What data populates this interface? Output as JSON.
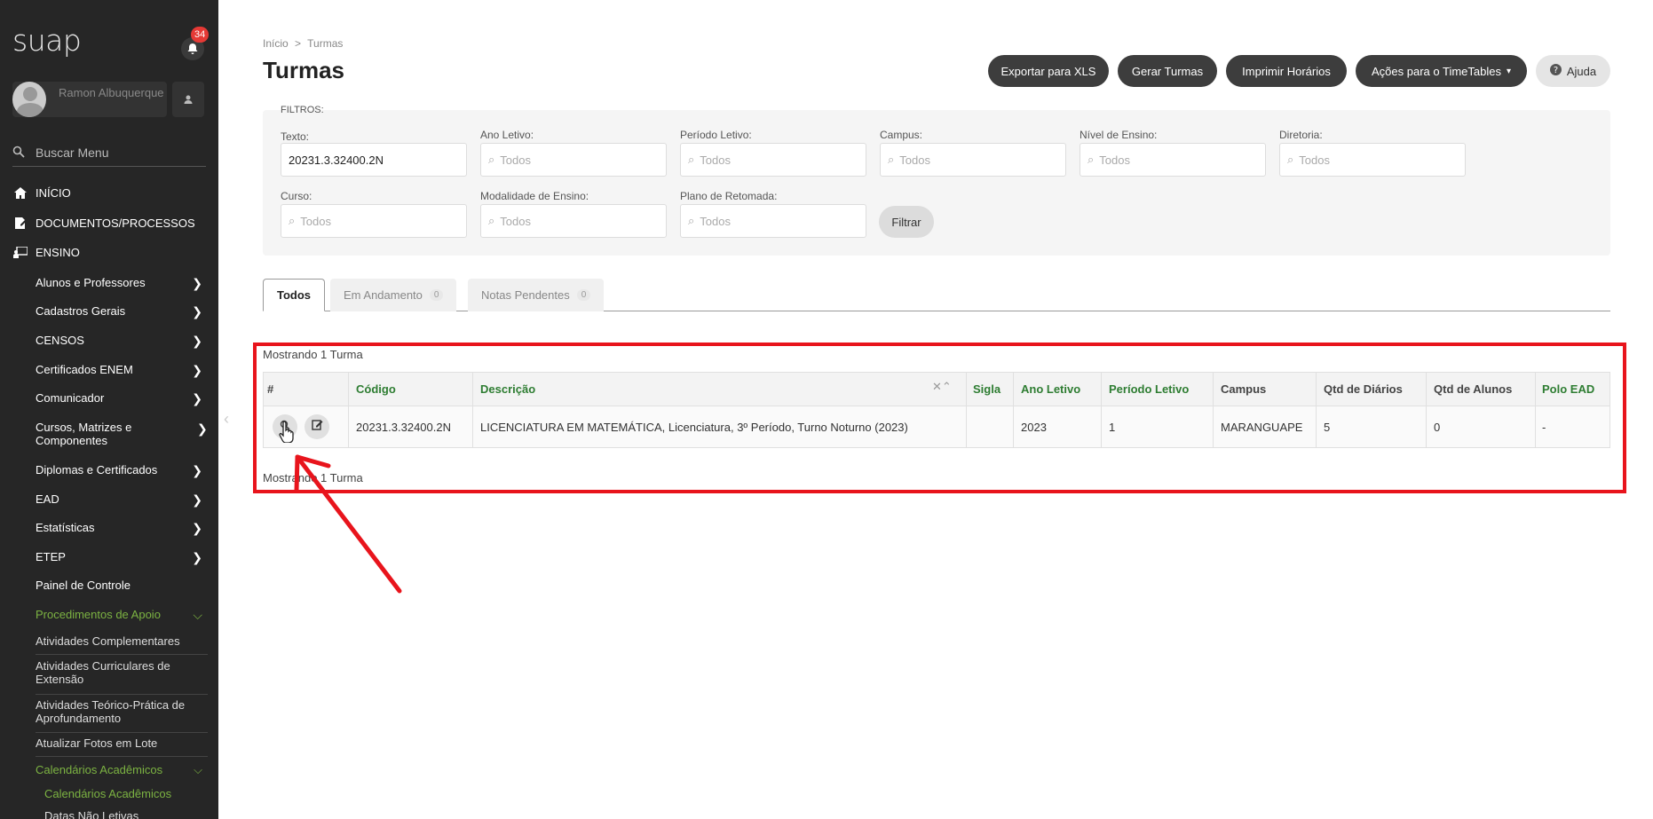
{
  "sidebar": {
    "logo": "suap",
    "notification_count": "34",
    "user_name": "Ramon Albuquerque",
    "search_placeholder": "Buscar Menu",
    "main_items": [
      "INÍCIO",
      "DOCUMENTOS/PROCESSOS",
      "ENSINO"
    ],
    "ensino_items": [
      "Alunos e Professores",
      "Cadastros Gerais",
      "CENSOS",
      "Certificados ENEM",
      "Comunicador",
      "Cursos, Matrizes e Componentes",
      "Diplomas e Certificados",
      "EAD",
      "Estatísticas",
      "ETEP",
      "Painel de Controle",
      "Procedimentos de Apoio"
    ],
    "apoio_items": [
      "Atividades Complementares",
      "Atividades Curriculares de Extensão",
      "Atividades Teórico-Prática de Aprofundamento",
      "Atualizar Fotos em Lote",
      "Calendários Acadêmicos"
    ],
    "calendar_items": [
      "Calendários Acadêmicos",
      "Datas Não Letivas"
    ]
  },
  "header": {
    "breadcrumb_home": "Início",
    "breadcrumb_sep": ">",
    "breadcrumb_current": "Turmas",
    "title": "Turmas",
    "buttons": {
      "export": "Exportar para XLS",
      "generate": "Gerar Turmas",
      "print": "Imprimir Horários",
      "actions": "Ações para o TimeTables",
      "help": "Ajuda"
    }
  },
  "filters": {
    "title": "FILTROS:",
    "texto_label": "Texto:",
    "texto_value": "20231.3.32400.2N",
    "ano_label": "Ano Letivo:",
    "periodo_label": "Período Letivo:",
    "campus_label": "Campus:",
    "nivel_label": "Nível de Ensino:",
    "diretoria_label": "Diretoria:",
    "curso_label": "Curso:",
    "modalidade_label": "Modalidade de Ensino:",
    "plano_label": "Plano de Retomada:",
    "placeholder": "Todos",
    "filter_button": "Filtrar"
  },
  "tabs": [
    {
      "label": "Todos",
      "count": ""
    },
    {
      "label": "Em Andamento",
      "count": "0"
    },
    {
      "label": "Notas Pendentes",
      "count": "0"
    }
  ],
  "results": {
    "showing_text": "Mostrando 1 Turma",
    "columns": [
      "#",
      "Código",
      "Descrição",
      "Sigla",
      "Ano Letivo",
      "Período Letivo",
      "Campus",
      "Qtd de Diários",
      "Qtd de Alunos",
      "Polo EAD"
    ],
    "row": {
      "codigo": "20231.3.32400.2N",
      "descricao": "LICENCIATURA EM MATEMÁTICA, Licenciatura, 3º Período, Turno Noturno (2023)",
      "sigla": "",
      "ano": "2023",
      "periodo": "1",
      "campus": "MARANGUAPE",
      "diarios": "5",
      "alunos": "0",
      "polo": "-"
    }
  },
  "colors": {
    "sidebar_bg": "#262626",
    "accent_green": "#2e7d32",
    "highlight_red": "#e8141c"
  }
}
